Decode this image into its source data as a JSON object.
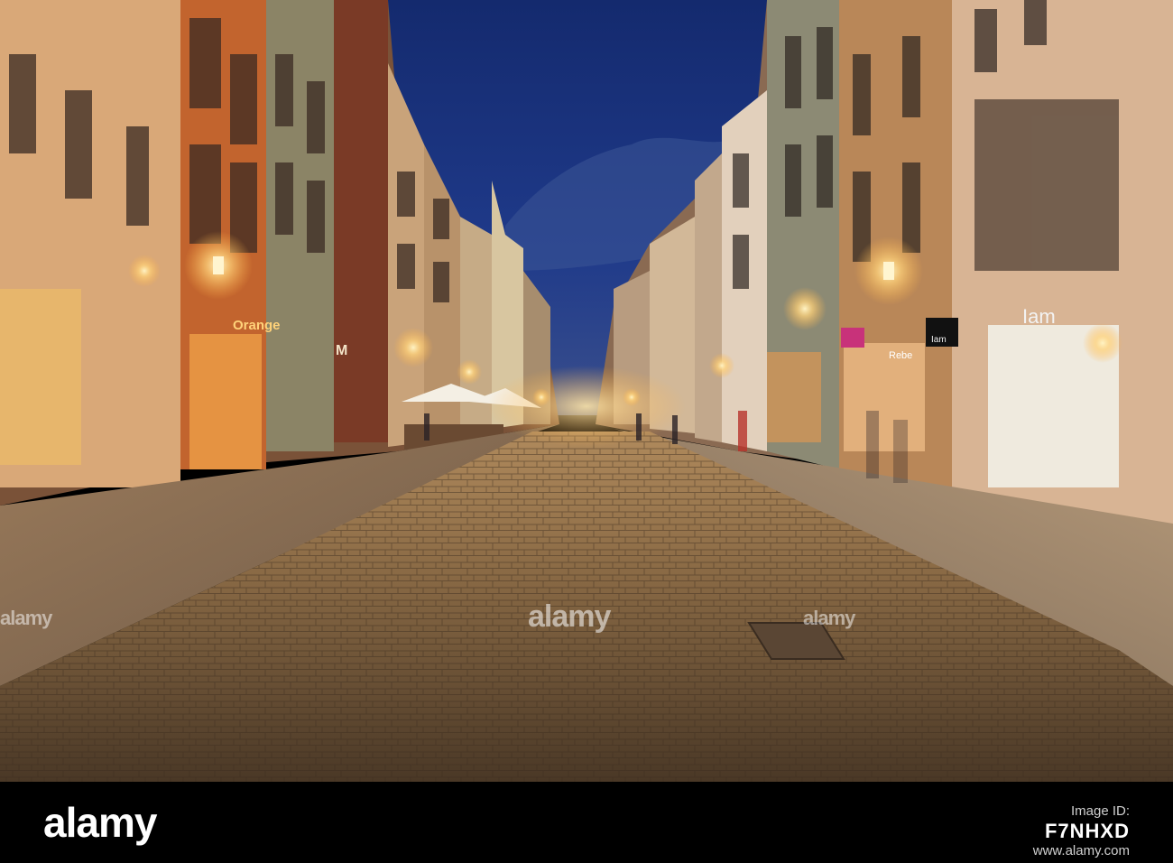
{
  "photo": {
    "scene_description_icon": "night-street-photo",
    "sky_color": "#1f3a8a",
    "lamp_color": "#ffd27a",
    "pavement_color": "#8a6a45"
  },
  "signs": {
    "orange_shop": "Orange",
    "iam_storefront": "Iam",
    "iam_small_sign": "Iam",
    "letter_m": "M",
    "pharmacy": "Rebe"
  },
  "watermarks": {
    "center": "alamy",
    "left": "alamy",
    "right": "alamy"
  },
  "footer": {
    "logo": "alamy",
    "id_label": "Image ID:",
    "id_value": "F7NHXD",
    "url": "www.alamy.com"
  }
}
